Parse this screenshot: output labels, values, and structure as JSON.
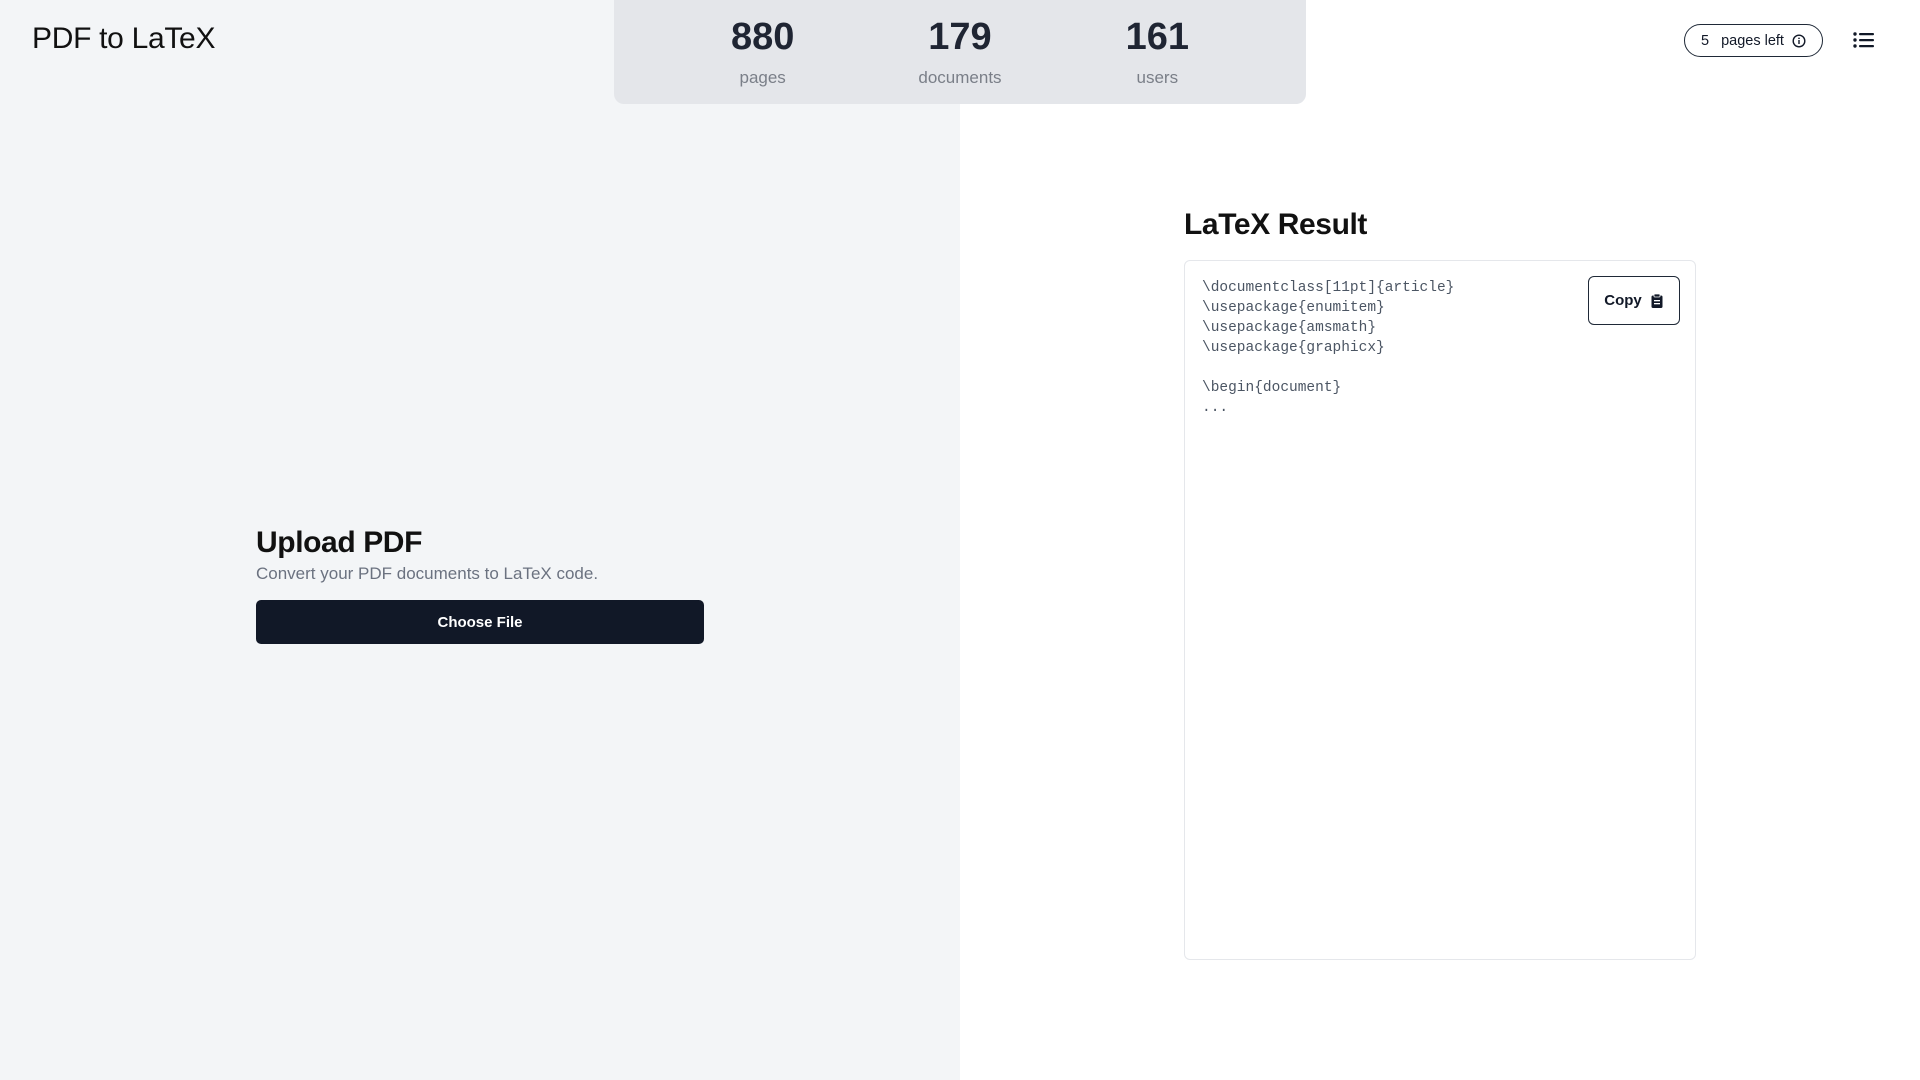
{
  "app": {
    "title": "PDF to LaTeX"
  },
  "stats": [
    {
      "value": "880",
      "label": "pages"
    },
    {
      "value": "179",
      "label": "documents"
    },
    {
      "value": "161",
      "label": "users"
    }
  ],
  "header": {
    "pages_left_count": "5",
    "pages_left_label": "pages left",
    "info_icon": "info-icon",
    "menu_icon": "list-menu-icon"
  },
  "upload": {
    "title": "Upload PDF",
    "subtitle": "Convert your PDF documents to LaTeX code.",
    "button_label": "Choose File"
  },
  "result": {
    "title": "LaTeX Result",
    "code": "\\documentclass[11pt]{article}\n\\usepackage{enumitem}\n\\usepackage{amsmath}\n\\usepackage{graphicx}\n\n\\begin{document}\n...",
    "copy_label": "Copy",
    "copy_icon": "clipboard-icon"
  },
  "colors": {
    "left_bg": "#f3f5f7",
    "stats_bg": "#e4e6ea",
    "primary_button": "#111827"
  }
}
